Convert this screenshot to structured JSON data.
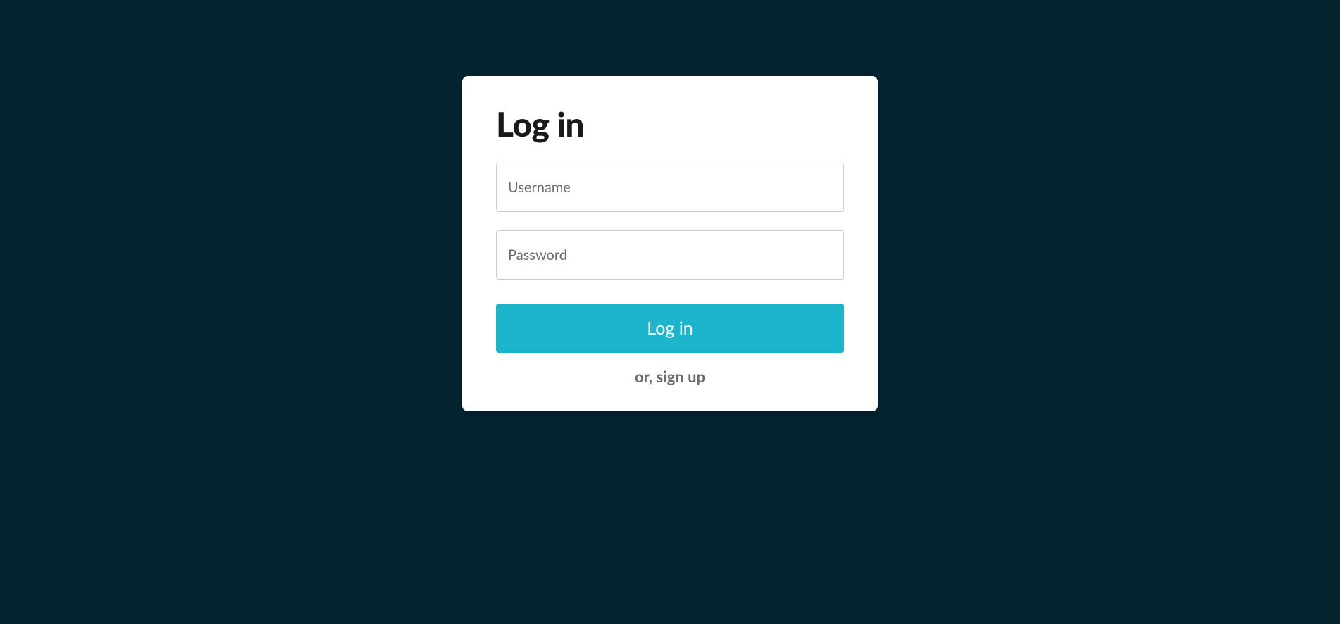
{
  "login": {
    "title": "Log in",
    "username_placeholder": "Username",
    "password_placeholder": "Password",
    "submit_label": "Log in",
    "signup_label": "or, sign up"
  }
}
